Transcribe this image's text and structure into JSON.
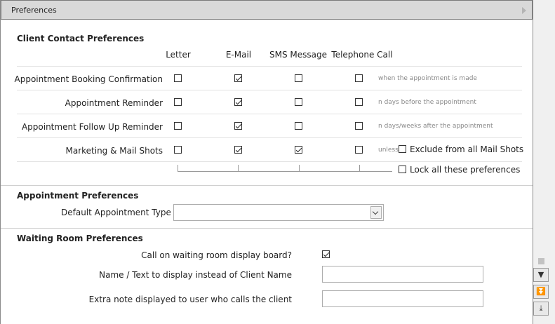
{
  "header": {
    "title": "Preferences"
  },
  "client_contact": {
    "title": "Client Contact Preferences",
    "columns": [
      "Letter",
      "E-Mail",
      "SMS Message",
      "Telephone Call"
    ],
    "rows": [
      {
        "label": "Appointment Booking Confirmation",
        "note": "when the appointment is made",
        "values": [
          false,
          true,
          false,
          false
        ]
      },
      {
        "label": "Appointment Reminder",
        "note": "n days before the appointment",
        "values": [
          false,
          true,
          false,
          false
        ]
      },
      {
        "label": "Appointment Follow Up Reminder",
        "note": "n days/weeks after the appointment",
        "values": [
          false,
          true,
          false,
          false
        ]
      },
      {
        "label": "Marketing & Mail Shots",
        "note": "unless:",
        "values": [
          false,
          true,
          true,
          false
        ]
      }
    ],
    "exclude_label": "Exclude from all Mail Shots",
    "exclude_checked": false,
    "lock_label": "Lock all these preferences",
    "lock_checked": false
  },
  "appointment": {
    "title": "Appointment Preferences",
    "type_label": "Default Appointment Type",
    "type_value": ""
  },
  "waiting_room": {
    "title": "Waiting Room Preferences",
    "display_label": "Call on waiting room display board?",
    "display_checked": true,
    "name_label": "Name / Text to display instead of Client Name",
    "name_value": "",
    "note_label": "Extra note displayed to user who calls the client",
    "note_value": ""
  },
  "scrollbar": {
    "buttons": [
      "scroll-down",
      "page-down",
      "scroll-to-end"
    ]
  }
}
